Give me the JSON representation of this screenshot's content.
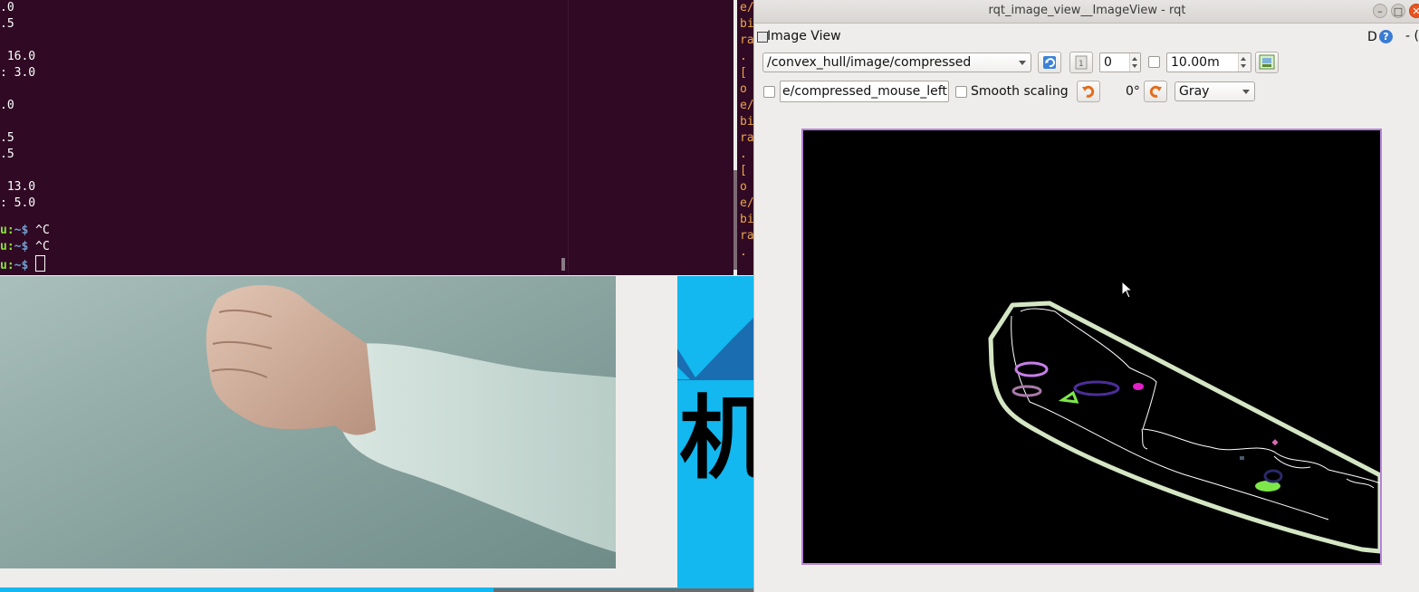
{
  "terminal": {
    "lines": [
      ".0",
      ".5",
      "",
      " 16.0",
      ": 3.0",
      "",
      ".0",
      "",
      ".5",
      ".5",
      "",
      " 13.0",
      ": 5.0",
      ""
    ],
    "prompt_user": "u:",
    "prompt_path": "~$",
    "commands": [
      "^C",
      "^C",
      ""
    ]
  },
  "terminal2": {
    "lines": [
      "e/",
      "bi",
      "ra",
      ".",
      "[",
      "o",
      "e/",
      "bi",
      "ra",
      ".",
      "[",
      "o",
      "e/",
      "bi",
      "ra",
      "."
    ]
  },
  "background_text": {
    "chinese_glyph": "机"
  },
  "window": {
    "title": "rqt_image_view__ImageView - rqt",
    "plugin_title": "Image View",
    "help_d": "D",
    "help_q": "?",
    "help_dash": "- ("
  },
  "toolbar": {
    "topic": "/convex_hull/image/compressed",
    "spin_value": "0",
    "duration_value": "10.00m",
    "mouse_topic": "e/compressed_mouse_left",
    "smooth_scaling_label": "Smooth scaling",
    "rotation_label": "0°",
    "colormap": "Gray"
  },
  "colors": {
    "hull": "#d4e6c4",
    "contour": "#ffffff",
    "blob_violet": "#c77ee8",
    "blob_mauve": "#a87aa8",
    "blob_indigo": "#4b2d9a",
    "blob_magenta": "#e020c8",
    "blob_green": "#7ee84a",
    "frame_border": "#b583d8"
  }
}
